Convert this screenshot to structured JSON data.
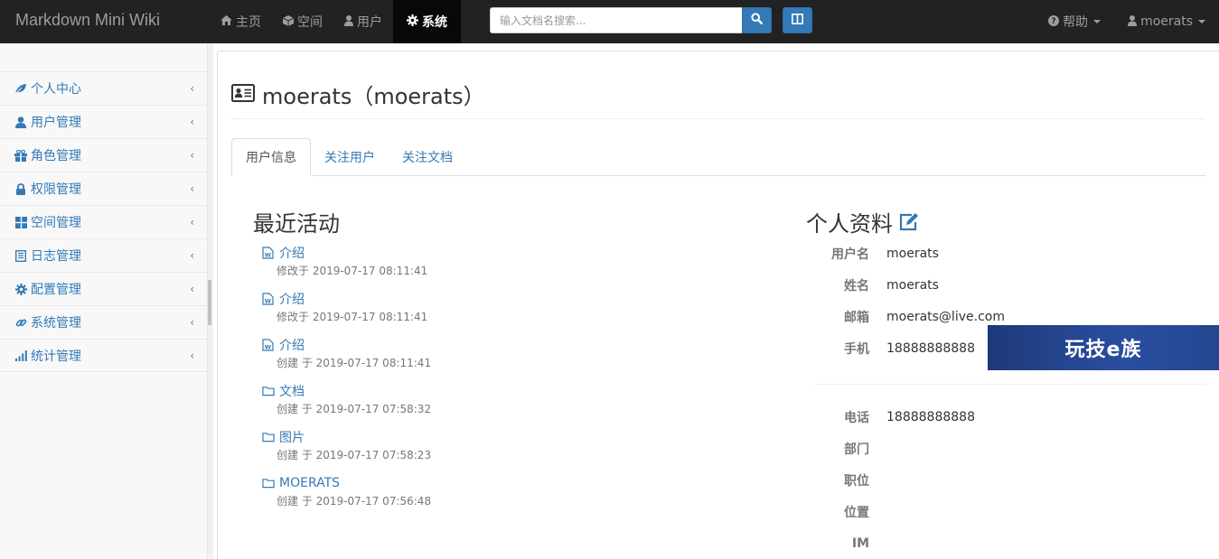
{
  "navbar": {
    "brand": "Markdown Mini Wiki",
    "items": [
      {
        "label": "主页",
        "icon": "home-icon"
      },
      {
        "label": "空间",
        "icon": "cube-icon"
      },
      {
        "label": "用户",
        "icon": "user-icon"
      },
      {
        "label": "系统",
        "icon": "gear-icon",
        "active": true
      }
    ],
    "search_placeholder": "输入文档名搜索...",
    "help_label": "帮助",
    "user_label": "moerats"
  },
  "sidebar": {
    "items": [
      {
        "label": "个人中心",
        "icon": "leaf-icon"
      },
      {
        "label": "用户管理",
        "icon": "user-icon"
      },
      {
        "label": "角色管理",
        "icon": "gift-icon"
      },
      {
        "label": "权限管理",
        "icon": "lock-icon"
      },
      {
        "label": "空间管理",
        "icon": "grid-icon"
      },
      {
        "label": "日志管理",
        "icon": "list-icon"
      },
      {
        "label": "配置管理",
        "icon": "cog-icon"
      },
      {
        "label": "系统管理",
        "icon": "link-icon"
      },
      {
        "label": "统计管理",
        "icon": "signal-icon"
      }
    ]
  },
  "main": {
    "title": "moerats（moerats）",
    "tabs": [
      "用户信息",
      "关注用户",
      "关注文档"
    ],
    "activity_title": "最近活动",
    "activities": [
      {
        "name": "介绍",
        "type": "doc",
        "meta": "修改于 2019-07-17 08:11:41"
      },
      {
        "name": "介绍",
        "type": "doc",
        "meta": "修改于 2019-07-17 08:11:41"
      },
      {
        "name": "介绍",
        "type": "doc",
        "meta": "创建 于 2019-07-17 08:11:41"
      },
      {
        "name": "文档",
        "type": "folder",
        "meta": "创建 于 2019-07-17 07:58:32"
      },
      {
        "name": "图片",
        "type": "folder",
        "meta": "创建 于 2019-07-17 07:58:23"
      },
      {
        "name": "MOERATS",
        "type": "folder",
        "meta": "创建 于 2019-07-17 07:56:48"
      }
    ],
    "profile_title": "个人资料",
    "profile": [
      {
        "label": "用户名",
        "value": "moerats"
      },
      {
        "label": "姓名",
        "value": "moerats"
      },
      {
        "label": "邮箱",
        "value": "moerats@live.com"
      },
      {
        "label": "手机",
        "value": "18888888888"
      },
      {
        "label": "电话",
        "value": "18888888888"
      },
      {
        "label": "部门",
        "value": ""
      },
      {
        "label": "职位",
        "value": ""
      },
      {
        "label": "位置",
        "value": ""
      },
      {
        "label": "IM",
        "value": ""
      }
    ]
  },
  "watermark": {
    "text": "玩技e族"
  },
  "colors": {
    "navbar": "#222222",
    "link": "#337ab7",
    "accent": "#337ab7"
  }
}
